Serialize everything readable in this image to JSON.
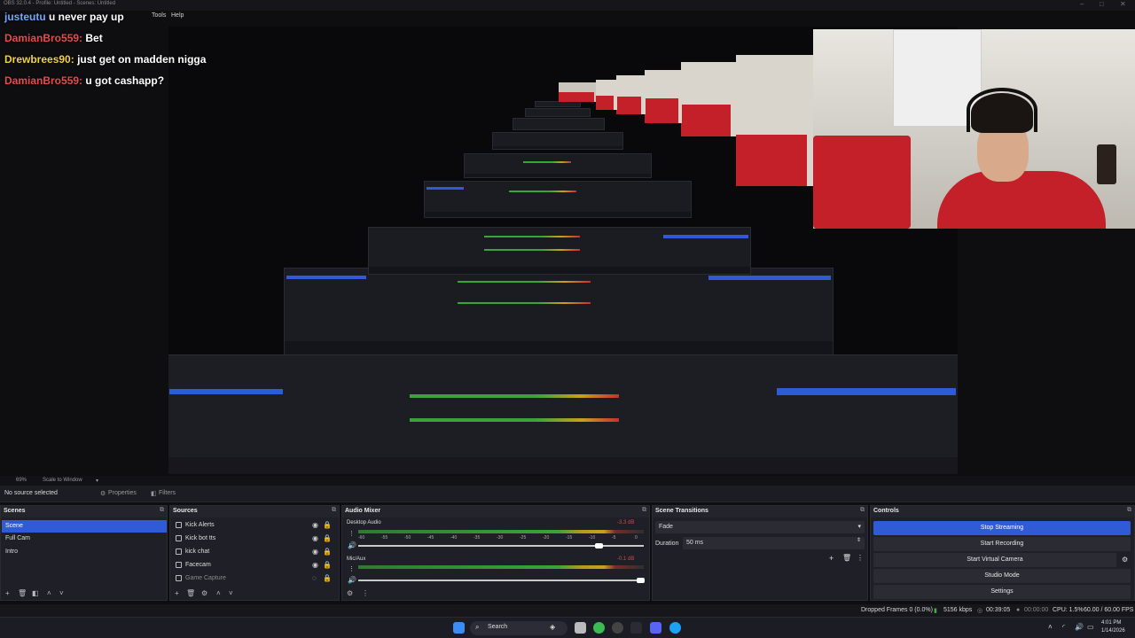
{
  "window": {
    "title": "OBS 32.0.4 - Profile: Untitled - Scenes: Untitled"
  },
  "menu": {
    "tools": "Tools",
    "help": "Help"
  },
  "chat": [
    {
      "user": "justeutu",
      "message": "u never pay up"
    },
    {
      "user": "DamianBro559:",
      "message": "Bet"
    },
    {
      "user": "Drewbrees90:",
      "message": "just get on madden nigga"
    },
    {
      "user": "DamianBro559:",
      "message": "u got cashapp?"
    }
  ],
  "zoom": {
    "level": "69%",
    "mode": "Scale to Window"
  },
  "propbar": {
    "no_source": "No source selected",
    "properties": "Properties",
    "filters": "Filters"
  },
  "scenes": {
    "title": "Scenes",
    "items": [
      "Scene",
      "Full Cam",
      "Intro"
    ]
  },
  "sources": {
    "title": "Sources",
    "items": [
      "Kick Alerts",
      "Kick bot tts",
      "kick chat",
      "Facecam",
      "Game Capture"
    ]
  },
  "audio_mixer": {
    "title": "Audio Mixer",
    "channels": [
      {
        "name": "Desktop Audio",
        "db": "-3.3 dB"
      },
      {
        "name": "Mic/Aux",
        "db": "-0.1 dB"
      }
    ],
    "scale": [
      "-60",
      "-55",
      "-50",
      "-45",
      "-40",
      "-35",
      "-30",
      "-25",
      "-20",
      "-15",
      "-10",
      "-5",
      "0"
    ]
  },
  "transitions": {
    "title": "Scene Transitions",
    "type": "Fade",
    "duration_label": "Duration",
    "duration": "50 ms"
  },
  "controls": {
    "title": "Controls",
    "buttons": [
      "Stop Streaming",
      "Start Recording",
      "Start Virtual Camera",
      "Studio Mode",
      "Settings"
    ]
  },
  "status": {
    "dropped": "Dropped Frames 0 (0.0%)",
    "bitrate": "5156 kbps",
    "stream_time": "00:39:05",
    "rec_time": "00:00:00",
    "cpu": "CPU: 1.5%",
    "fps": "60.00 / 60.00 FPS"
  },
  "taskbar": {
    "search": "Search",
    "time": "4:01 PM",
    "date": "1/14/2026"
  },
  "colors": {
    "accent": "#2f5bd6",
    "chat_name": "#e64b4b"
  }
}
